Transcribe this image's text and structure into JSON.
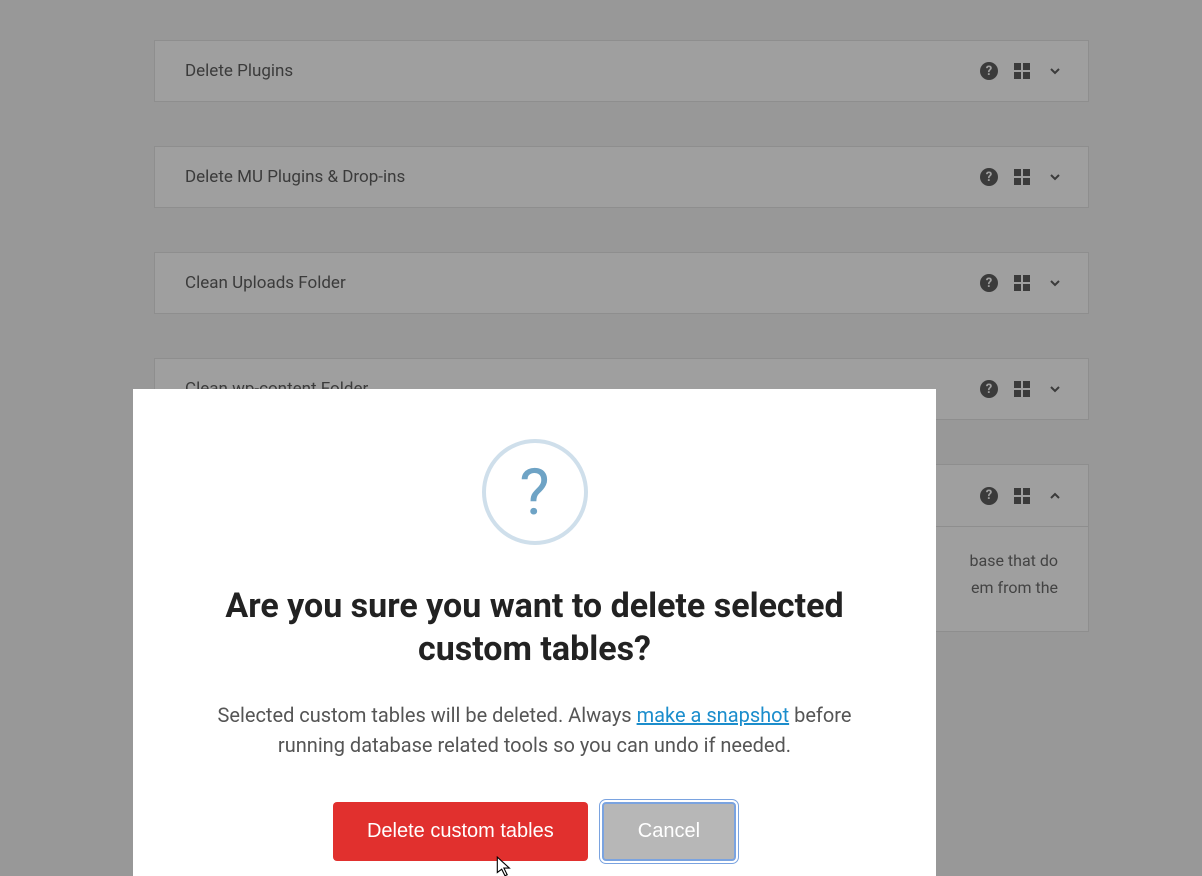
{
  "panels": [
    {
      "title": "Delete Plugins",
      "expanded": false
    },
    {
      "title": "Delete MU Plugins & Drop-ins",
      "expanded": false
    },
    {
      "title": "Clean Uploads Folder",
      "expanded": false
    },
    {
      "title": "Clean wp-content Folder",
      "expanded": false
    },
    {
      "title_hidden": true,
      "expanded": true,
      "desc_fragment_right": "base that do",
      "desc_fragment_right2": "em from the"
    }
  ],
  "modal": {
    "icon_label": "?",
    "title": "Are you sure you want to delete selected custom tables?",
    "body_before": "Selected custom tables will be deleted. Always ",
    "body_link": "make a snapshot",
    "body_after": " before running database related tools so you can undo if needed.",
    "confirm_label": "Delete custom tables",
    "cancel_label": "Cancel"
  }
}
